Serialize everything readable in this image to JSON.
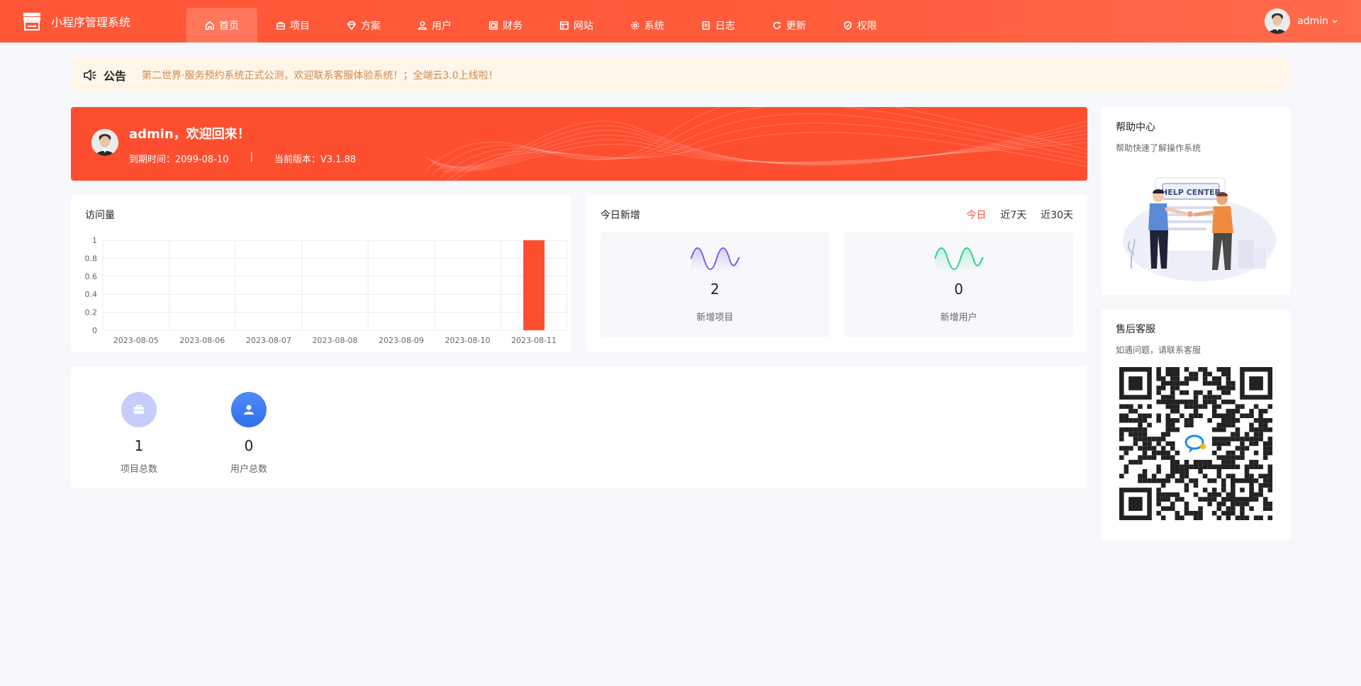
{
  "app": {
    "name": "小程序管理系统"
  },
  "nav": {
    "items": [
      {
        "label": "首页",
        "icon": "home-icon",
        "active": true
      },
      {
        "label": "项目",
        "icon": "briefcase-icon"
      },
      {
        "label": "方案",
        "icon": "gem-icon"
      },
      {
        "label": "用户",
        "icon": "user-icon"
      },
      {
        "label": "财务",
        "icon": "finance-icon"
      },
      {
        "label": "网站",
        "icon": "layout-icon"
      },
      {
        "label": "系统",
        "icon": "gear-icon"
      },
      {
        "label": "日志",
        "icon": "log-icon"
      },
      {
        "label": "更新",
        "icon": "refresh-icon"
      },
      {
        "label": "权限",
        "icon": "shield-icon"
      }
    ]
  },
  "user": {
    "name": "admin"
  },
  "notice": {
    "title": "公告",
    "text": "第二世界·服务预约系统正式公测，欢迎联系客服体验系统！；全端云3.0上线啦！"
  },
  "welcome": {
    "title": "admin，欢迎回来！",
    "expire": "到期时间：2099-08-10",
    "separator": "|",
    "version": "当前版本：V3.1.88"
  },
  "visits": {
    "title": "访问量"
  },
  "chart_data": {
    "type": "bar",
    "title": "访问量",
    "categories": [
      "2023-08-05",
      "2023-08-06",
      "2023-08-07",
      "2023-08-08",
      "2023-08-09",
      "2023-08-10",
      "2023-08-11"
    ],
    "values": [
      0,
      0,
      0,
      0,
      0,
      0,
      1
    ],
    "ylim": [
      0,
      1
    ],
    "yticks": [
      "0",
      "0.2",
      "0.4",
      "0.6",
      "0.8",
      "1"
    ],
    "grid": true,
    "bar_color": "#fe4e30"
  },
  "today": {
    "title": "今日新增",
    "tabs": [
      "今日",
      "近7天",
      "近30天"
    ],
    "stats": [
      {
        "value": "2",
        "label": "新增项目",
        "color": "#7b5cf0"
      },
      {
        "value": "0",
        "label": "新增用户",
        "color": "#2fcf8f"
      }
    ]
  },
  "totals": [
    {
      "value": "1",
      "label": "项目总数",
      "icon": "briefcase-icon",
      "color": "#c7cdfb"
    },
    {
      "value": "0",
      "label": "用户总数",
      "icon": "user-icon",
      "color": "#3e7cf5"
    }
  ],
  "help": {
    "title": "帮助中心",
    "subtitle": "帮助快速了解操作系统",
    "image_text": "HELP CENTER"
  },
  "service": {
    "title": "售后客服",
    "subtitle": "如遇问题，请联系客服"
  }
}
